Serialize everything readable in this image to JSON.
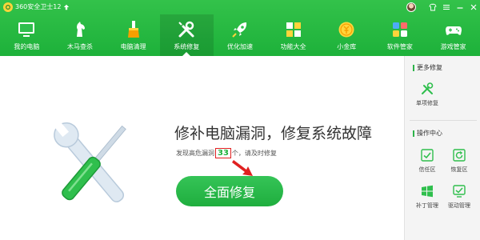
{
  "titlebar": {
    "app_title": "360安全卫士12",
    "logo_icon": "360-logo-icon",
    "upgrade_icon": "up-arrow-icon",
    "controls": [
      "shirt-icon",
      "menu-icon",
      "minimize-icon",
      "close-icon"
    ]
  },
  "nav": {
    "items": [
      {
        "label": "我的电脑",
        "icon": "monitor-icon"
      },
      {
        "label": "木马查杀",
        "icon": "horse-icon"
      },
      {
        "label": "电脑清理",
        "icon": "broom-icon"
      },
      {
        "label": "系统修复",
        "icon": "wrench-screwdriver-icon",
        "active": true
      },
      {
        "label": "优化加速",
        "icon": "rocket-icon"
      },
      {
        "label": "功能大全",
        "icon": "grid-icon"
      },
      {
        "label": "小金库",
        "icon": "coin-icon"
      },
      {
        "label": "软件管家",
        "icon": "apps-icon"
      },
      {
        "label": "游戏管家",
        "icon": "gamepad-icon"
      }
    ]
  },
  "main": {
    "headline": "修补电脑漏洞，修复系统故障",
    "sub_prefix": "发现高危漏洞",
    "vuln_count": "33",
    "sub_suffix": "个，请及时修复",
    "repair_button": "全面修复"
  },
  "sidebar": {
    "more_title": "更多修复",
    "more_items": [
      {
        "label": "单项修复",
        "icon": "wrench-screwdriver-icon"
      }
    ],
    "ops_title": "操作中心",
    "ops_items": [
      {
        "label": "信任区",
        "icon": "trust-zone-icon"
      },
      {
        "label": "恢复区",
        "icon": "restore-zone-icon"
      },
      {
        "label": "补丁管理",
        "icon": "windows-icon"
      },
      {
        "label": "驱动管理",
        "icon": "driver-icon"
      }
    ]
  },
  "colors": {
    "brand_green": "#1db13a",
    "highlight_red": "#e02020"
  }
}
